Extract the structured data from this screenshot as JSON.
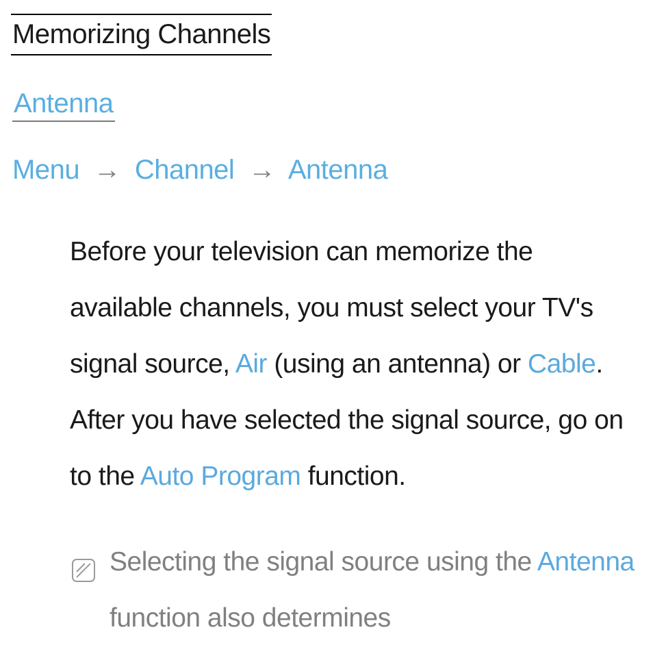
{
  "title": "Memorizing Channels",
  "section_heading": "Antenna",
  "breadcrumb": {
    "items": [
      "Menu",
      "Channel",
      "Antenna"
    ],
    "separator": "→"
  },
  "body": {
    "seg1": "Before your television can memorize the available channels, you must select your TV's signal source, ",
    "air": "Air",
    "seg2": " (using an antenna) or ",
    "cable": "Cable",
    "seg3": ". After you have selected the signal source, go on to the ",
    "auto_program": "Auto Program",
    "seg4": " function."
  },
  "note": {
    "seg1": "Selecting the signal source using the ",
    "antenna": "Antenna",
    "seg2": " function also determines"
  }
}
